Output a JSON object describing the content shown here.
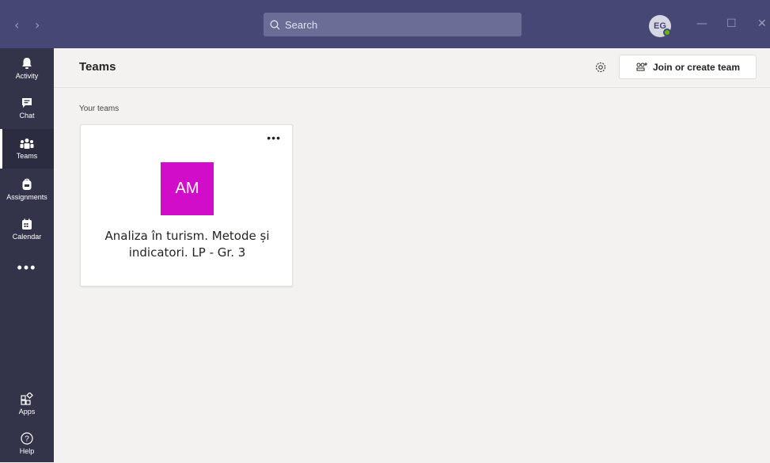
{
  "titlebar": {
    "search_placeholder": "Search",
    "avatar_initials": "EG",
    "back_glyph": "‹",
    "forward_glyph": "›",
    "minimize_glyph": "—",
    "maximize_glyph": "☐",
    "close_glyph": "✕",
    "bg_color": "#464775"
  },
  "rail": {
    "items": [
      {
        "label": "Activity",
        "icon": "bell-icon"
      },
      {
        "label": "Chat",
        "icon": "chat-icon"
      },
      {
        "label": "Teams",
        "icon": "teams-icon",
        "active": true
      },
      {
        "label": "Assignments",
        "icon": "backpack-icon"
      },
      {
        "label": "Calendar",
        "icon": "calendar-icon"
      }
    ],
    "more": "•••",
    "bottom": [
      {
        "label": "Apps",
        "icon": "apps-icon"
      },
      {
        "label": "Help",
        "icon": "help-icon"
      }
    ]
  },
  "header": {
    "title": "Teams",
    "join_label": "Join or create team"
  },
  "main": {
    "section_label": "Your teams",
    "teams": [
      {
        "initials": "AM",
        "name": "Analiza în turism. Metode și indicatori. LP - Gr. 3",
        "more": "•••",
        "tile_color": "#d10dc9"
      }
    ]
  }
}
